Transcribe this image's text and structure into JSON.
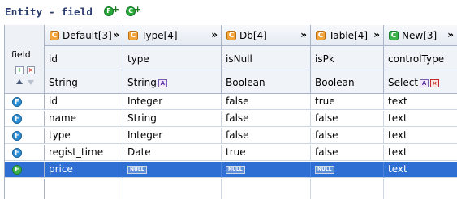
{
  "window": {
    "title": "Entity - field",
    "title_buttons": [
      {
        "name": "add-field-button",
        "glyph": "F",
        "suffix": "+"
      },
      {
        "name": "add-column-button",
        "glyph": "C",
        "suffix": "+"
      }
    ]
  },
  "grid": {
    "row_header": {
      "label": "field"
    },
    "groups": [
      {
        "label": "Default[3]",
        "chevron": "»",
        "badge": "C",
        "badge_color": "#f2a33a"
      },
      {
        "label": "Type[4]",
        "chevron": "»",
        "badge": "C",
        "badge_color": "#f2a33a"
      },
      {
        "label": "Db[4]",
        "chevron": "»",
        "badge": "C",
        "badge_color": "#f2a33a"
      },
      {
        "label": "Table[4]",
        "chevron": "»",
        "badge": "C",
        "badge_color": "#f2a33a"
      },
      {
        "label": "New[3]",
        "chevron": "»",
        "badge": "C",
        "badge_color": "#3bb24a"
      }
    ],
    "columns": [
      {
        "name": "id",
        "type": "String"
      },
      {
        "name": "type",
        "type": "String"
      },
      {
        "name": "isNull",
        "type": "Boolean"
      },
      {
        "name": "isPk",
        "type": "Boolean"
      },
      {
        "name": "controlType",
        "type": "Select"
      }
    ],
    "rows": [
      {
        "badge": "F",
        "cells": [
          "id",
          "Integer",
          "false",
          "true",
          "text"
        ]
      },
      {
        "badge": "F",
        "cells": [
          "name",
          "String",
          "false",
          "false",
          "text"
        ]
      },
      {
        "badge": "F",
        "cells": [
          "type",
          "Integer",
          "false",
          "false",
          "text"
        ]
      },
      {
        "badge": "F",
        "cells": [
          "regist_time",
          "Date",
          "true",
          "false",
          "text"
        ]
      },
      {
        "badge": "F",
        "cells": [
          "price",
          "NULL",
          "NULL",
          "NULL",
          "text"
        ],
        "null_cells": [
          1,
          2,
          3
        ],
        "selected": true
      }
    ],
    "colors": {
      "selection": "#2f6fd3",
      "grid_line": "#a9b5c7",
      "title": "#2a3b6e"
    }
  }
}
